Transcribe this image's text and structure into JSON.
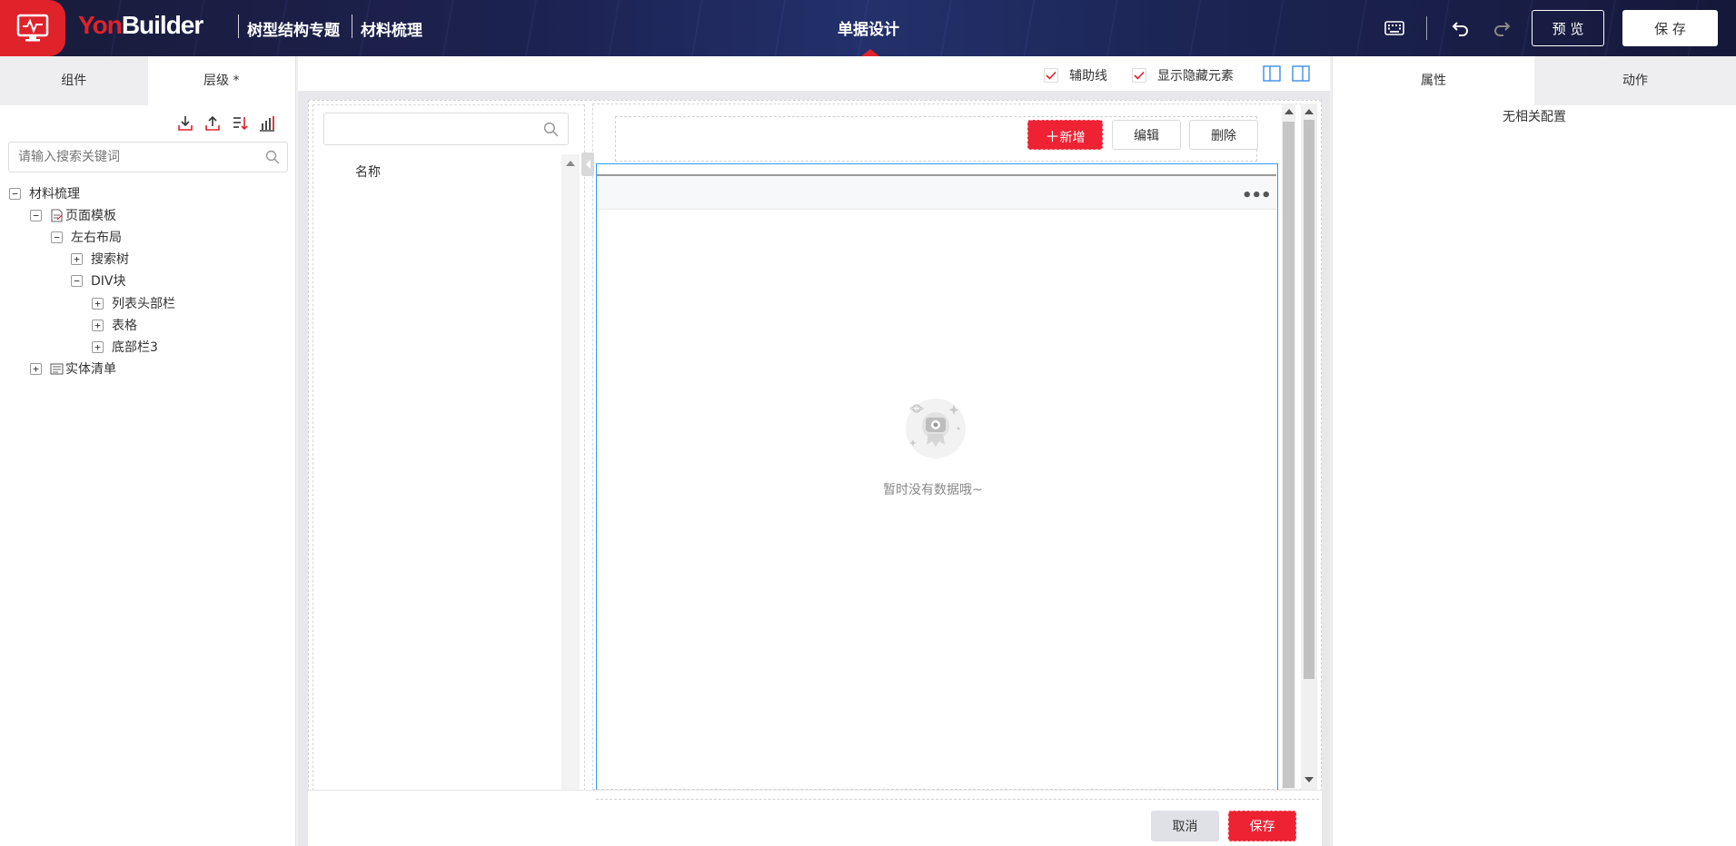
{
  "header": {
    "brand_yon": "Yon",
    "brand_builder": "Builder",
    "crumbs": [
      "树型结构专题",
      "材料梳理"
    ],
    "center_title": "单据设计",
    "preview_label": "预 览",
    "save_label": "保 存",
    "icons": [
      "keyboard-icon",
      "undo-icon",
      "redo-icon"
    ]
  },
  "left_panel": {
    "tabs": [
      {
        "label": "组件",
        "active": false
      },
      {
        "label": "层级 *",
        "active": true
      }
    ],
    "toolbar_icons": [
      "import-icon",
      "export-icon",
      "sort-icon",
      "chart-icon"
    ],
    "search_placeholder": "请输入搜索关键词",
    "tree": [
      {
        "label": "材料梳理",
        "toggle": "−",
        "level": 0
      },
      {
        "label": "页面模板",
        "toggle": "−",
        "level": 1,
        "icon": "page-template-icon"
      },
      {
        "label": "左右布局",
        "toggle": "−",
        "level": 2
      },
      {
        "label": "搜索树",
        "toggle": "+",
        "level": 3
      },
      {
        "label": "DIV块",
        "toggle": "−",
        "level": 3
      },
      {
        "label": "列表头部栏",
        "toggle": "+",
        "level": 4
      },
      {
        "label": "表格",
        "toggle": "+",
        "level": 4
      },
      {
        "label": "底部栏3",
        "toggle": "+",
        "level": 4
      },
      {
        "label": "实体清单",
        "toggle": "+",
        "level": 1,
        "icon": "entity-list-icon"
      }
    ]
  },
  "canvas": {
    "checkbox_guides": "辅助线",
    "checkbox_hidden": "显示隐藏元素",
    "tree_column_header": "名称",
    "add_button": "新增",
    "edit_button": "编辑",
    "delete_button": "删除",
    "empty_text": "暂时没有数据哦~",
    "cancel_button": "取消",
    "save_button": "保存"
  },
  "right_panel": {
    "tabs": [
      {
        "label": "属性",
        "active": true
      },
      {
        "label": "动作",
        "active": false
      }
    ],
    "no_config": "无相关配置"
  },
  "colors": {
    "brand_red": "#e0222b",
    "accent_red": "#ee2233",
    "selection_blue": "#2f9bff",
    "header_navy": "#1c2250"
  }
}
